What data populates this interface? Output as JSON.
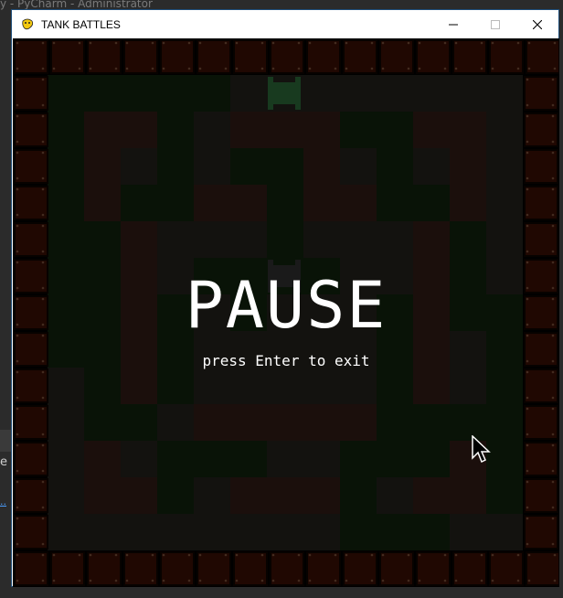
{
  "background": {
    "ide_title_fragment": "y - PyCharm - Administrator",
    "side_char_1": "e"
  },
  "window": {
    "title": "TANK BATTLES",
    "icon": "pygame-snake-icon",
    "controls": [
      "minimize-icon",
      "maximize-icon",
      "close-icon"
    ]
  },
  "game": {
    "pause_title": "PAUSE",
    "pause_hint": "press Enter to exit",
    "colors": {
      "brick": "#2b0b03",
      "brick_border": "#0a0300",
      "grass": "#0d1a0a",
      "floor": "#1a1815",
      "wall": "#251511",
      "overlay_text": "#ffffff"
    },
    "tanks": [
      {
        "name": "enemy-tank",
        "color": "#183a1f"
      },
      {
        "name": "player-tank",
        "color": "#1a1a1a"
      }
    ]
  }
}
